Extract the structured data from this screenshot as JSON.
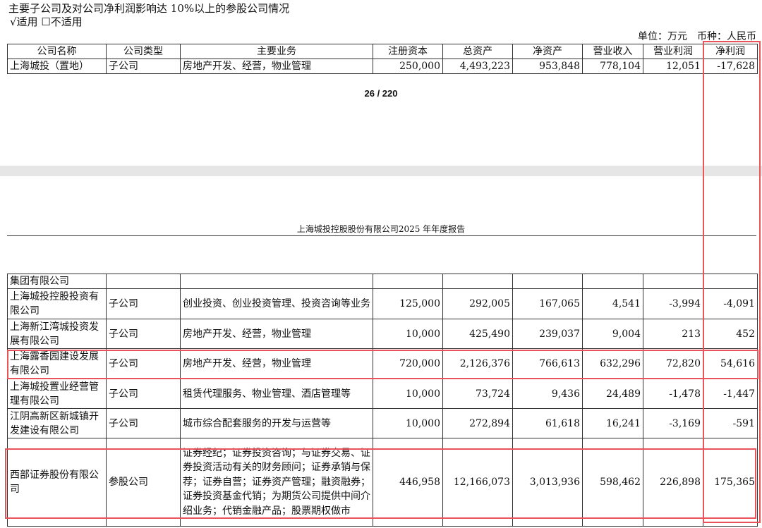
{
  "heading": "主要子公司及对公司净利润影响达 10%以上的参股公司情况",
  "applicable": "√适用 ☐不适用",
  "unit": "单位：万元　币种：人民币",
  "columns": [
    "公司名称",
    "公司类型",
    "主要业务",
    "注册资本",
    "总资产",
    "净资产",
    "营业收入",
    "营业利润",
    "净利润"
  ],
  "top_rows": [
    [
      "上海城投（置地）",
      "子公司",
      "房地产开发、经营，物业管理",
      "250,000",
      "4,493,223",
      "953,848",
      "778,104",
      "12,051",
      "-17,628"
    ]
  ],
  "page_indicator": "26 / 220",
  "report_header": "上海城投控股股份有限公司2025 年年度报告",
  "rows": [
    [
      "集团有限公司",
      "",
      "",
      "",
      "",
      "",
      "",
      "",
      ""
    ],
    [
      "上海城投控股投资有限公司",
      "子公司",
      "创业投资、创业投资管理、投资咨询等业务",
      "125,000",
      "292,005",
      "167,065",
      "4,541",
      "-3,994",
      "-4,091"
    ],
    [
      "上海新江湾城投资发展有限公司",
      "子公司",
      "房地产开发、经营，物业管理",
      "10,000",
      "425,490",
      "239,037",
      "9,004",
      "213",
      "452"
    ],
    [
      "上海露香园建设发展有限公司",
      "子公司",
      "房地产开发、经营，物业管理",
      "720,000",
      "2,126,376",
      "766,613",
      "632,296",
      "72,820",
      "54,616"
    ],
    [
      "上海城投置业经营管理有限公司",
      "子公司",
      "租赁代理服务、物业管理、酒店管理等",
      "10,000",
      "73,724",
      "9,436",
      "24,489",
      "-1,478",
      "-1,447"
    ],
    [
      "江阴高新区新城镇开发建设有限公司",
      "子公司",
      "城市综合配套服务的开发与运营等",
      "10,000",
      "272,894",
      "61,618",
      "16,241",
      "-3,169",
      "-591"
    ],
    [
      "西部证券股份有限公司",
      "参股公司",
      "证券经纪；证券投资咨询；与证券交易、证券投资活动有关的财务顾问；证券承销与保荐；证券自营；证券资产管理；融资融券；证券投资基金代销；为期货公司提供中间介绍业务；代销金融产品；股票期权做市",
      "446,958",
      "12,166,073",
      "3,013,936",
      "598,462",
      "226,898",
      "175,365"
    ]
  ],
  "highlight_color": "#e8545a"
}
